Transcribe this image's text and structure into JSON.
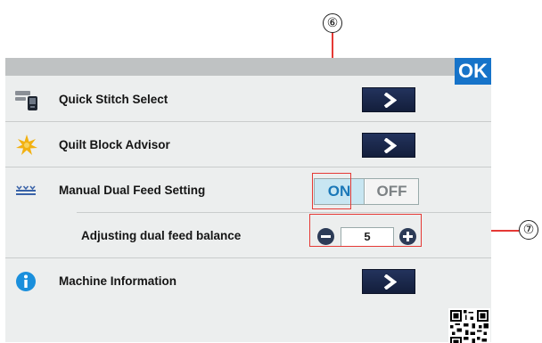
{
  "callouts": {
    "callout_6": "⑥",
    "callout_7": "⑦"
  },
  "header": {
    "ok_label": "OK"
  },
  "rows": [
    {
      "label": "Quick Stitch Select",
      "icon": "quick-stitch-select-icon",
      "control": "arrow-button"
    },
    {
      "label": "Quilt Block Advisor",
      "icon": "quilt-block-advisor-icon",
      "control": "arrow-button"
    },
    {
      "label": "Manual Dual Feed Setting",
      "icon": "dual-feed-icon",
      "control": "toggle"
    },
    {
      "label": "Adjusting dual feed balance",
      "control": "stepper"
    },
    {
      "label": "Machine Information",
      "icon": "info-icon",
      "control": "arrow-button"
    }
  ],
  "toggle": {
    "on_label": "ON",
    "off_label": "OFF",
    "selected": "ON"
  },
  "stepper": {
    "value": "5"
  },
  "colors": {
    "ok_blue": "#1673c9",
    "arrow_button_navy": "#1b284b",
    "toggle_on_bg": "#c8e6f2",
    "toggle_on_text": "#1a78b8",
    "callout_line": "#e53935",
    "info_icon": "#1a8fdc",
    "star_icon": "#f2b111"
  },
  "icons": {
    "arrow": "chevron-right-icon",
    "qr": "qr-code-icon"
  }
}
